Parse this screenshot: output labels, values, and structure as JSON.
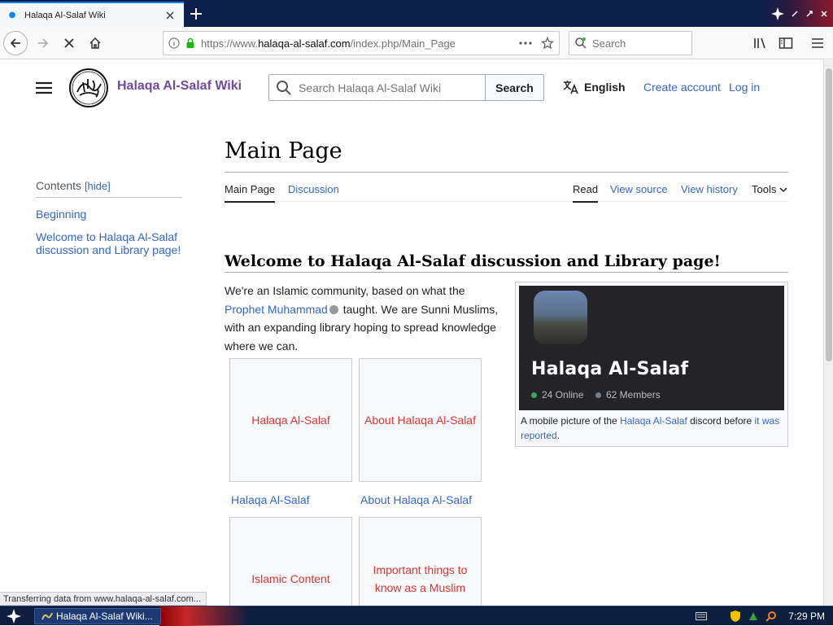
{
  "browser": {
    "tab_title": "Halaqa Al-Salaf Wiki",
    "url_prefix": "https://www.",
    "url_domain": "halaqa-al-salaf.com",
    "url_path": "/index.php/Main_Page",
    "search_placeholder": "Search"
  },
  "header": {
    "wordmark": "Halaqa Al-Salaf Wiki",
    "search_placeholder": "Search Halaqa Al-Salaf Wiki",
    "search_button": "Search",
    "language": "English",
    "create_account": "Create account",
    "log_in": "Log in"
  },
  "toc": {
    "heading": "Contents",
    "hide": "[hide]",
    "items": [
      "Beginning",
      "Welcome to Halaqa Al-Salaf discussion and Library page!"
    ]
  },
  "page": {
    "title": "Main Page",
    "tabs": {
      "main": "Main Page",
      "discussion": "Discussion",
      "read": "Read",
      "view_source": "View source",
      "view_history": "View history",
      "tools": "Tools"
    },
    "section_heading": "Welcome to Halaqa Al-Salaf discussion and Library page!",
    "intro": {
      "part1": "We're an Islamic community, based on what the ",
      "link": "Prophet Muhammad",
      "part2": " taught. We are Sunni Muslims, with an expanding library hoping to spread knowledge where we can."
    }
  },
  "infobox": {
    "server_name": "Halaqa Al-Salaf",
    "online": "24 Online",
    "members": "62 Members",
    "caption_pre": "A mobile picture of the ",
    "caption_link1": "Halaqa Al-Salaf",
    "caption_mid": " discord before ",
    "caption_link2": "it was reported",
    "caption_end": "."
  },
  "tiles": [
    {
      "text": "Halaqa Al-Salaf",
      "label": "Halaqa Al-Salaf"
    },
    {
      "text": "About Halaqa Al-Salaf",
      "label": "About Halaqa Al-Salaf"
    },
    {
      "text": "Islamic Content",
      "label": ""
    },
    {
      "text": "Important things to know as a Muslim",
      "label": ""
    }
  ],
  "status": "Transferring data from www.halaqa-al-salaf.com...",
  "taskbar": {
    "item": "Halaqa Al-Salaf Wiki...",
    "clock": "7:29 PM"
  },
  "colors": {
    "link": "#3366cc",
    "redlink": "#d33",
    "wordmark": "#6e4aa0",
    "discord_bg": "#242428",
    "online": "#3ba55c",
    "members": "#747f8d"
  },
  "icons": [
    "tab-favicon",
    "close-icon",
    "plus-icon",
    "back-icon",
    "forward-icon",
    "stop-icon",
    "home-icon",
    "info-icon",
    "lock-icon",
    "more-icon",
    "star-icon",
    "search-icon",
    "library-icon",
    "sidebar-icon",
    "menu-icon",
    "translate-icon",
    "chevron-down-icon"
  ]
}
